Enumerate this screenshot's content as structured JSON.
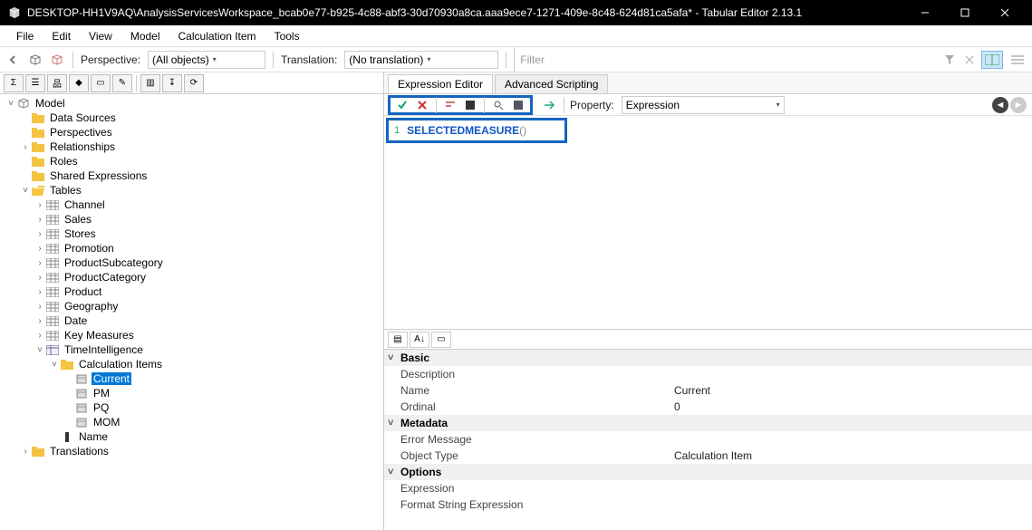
{
  "window": {
    "title": "DESKTOP-HH1V9AQ\\AnalysisServicesWorkspace_bcab0e77-b925-4c88-abf3-30d70930a8ca.aaa9ece7-1271-409e-8c48-624d81ca5afa* - Tabular Editor 2.13.1"
  },
  "menu": [
    "File",
    "Edit",
    "View",
    "Model",
    "Calculation Item",
    "Tools"
  ],
  "toolbar": {
    "perspective_label": "Perspective:",
    "perspective_value": "(All objects)",
    "translation_label": "Translation:",
    "translation_value": "(No translation)",
    "filter_placeholder": "Filter"
  },
  "tree": [
    {
      "d": 0,
      "t": "v",
      "i": "cube",
      "l": "Model"
    },
    {
      "d": 1,
      "t": "",
      "i": "folder",
      "l": "Data Sources"
    },
    {
      "d": 1,
      "t": "",
      "i": "folder",
      "l": "Perspectives"
    },
    {
      "d": 1,
      "t": ">",
      "i": "folder",
      "l": "Relationships"
    },
    {
      "d": 1,
      "t": "",
      "i": "folder",
      "l": "Roles"
    },
    {
      "d": 1,
      "t": "",
      "i": "folder",
      "l": "Shared Expressions"
    },
    {
      "d": 1,
      "t": "v",
      "i": "folder-open",
      "l": "Tables"
    },
    {
      "d": 2,
      "t": ">",
      "i": "table",
      "l": "Channel"
    },
    {
      "d": 2,
      "t": ">",
      "i": "table",
      "l": "Sales"
    },
    {
      "d": 2,
      "t": ">",
      "i": "table",
      "l": "Stores"
    },
    {
      "d": 2,
      "t": ">",
      "i": "table",
      "l": "Promotion"
    },
    {
      "d": 2,
      "t": ">",
      "i": "table",
      "l": "ProductSubcategory"
    },
    {
      "d": 2,
      "t": ">",
      "i": "table",
      "l": "ProductCategory"
    },
    {
      "d": 2,
      "t": ">",
      "i": "table",
      "l": "Product"
    },
    {
      "d": 2,
      "t": ">",
      "i": "table",
      "l": "Geography"
    },
    {
      "d": 2,
      "t": ">",
      "i": "table",
      "l": "Date"
    },
    {
      "d": 2,
      "t": ">",
      "i": "table",
      "l": "Key Measures"
    },
    {
      "d": 2,
      "t": "v",
      "i": "calcgroup",
      "l": "TimeIntelligence"
    },
    {
      "d": 3,
      "t": "v",
      "i": "folder",
      "l": "Calculation Items"
    },
    {
      "d": 4,
      "t": "",
      "i": "item",
      "l": "Current",
      "sel": true
    },
    {
      "d": 4,
      "t": "",
      "i": "item",
      "l": "PM"
    },
    {
      "d": 4,
      "t": "",
      "i": "item",
      "l": "PQ"
    },
    {
      "d": 4,
      "t": "",
      "i": "item",
      "l": "MOM"
    },
    {
      "d": 3,
      "t": "",
      "i": "col",
      "l": "Name"
    },
    {
      "d": 1,
      "t": ">",
      "i": "folder",
      "l": "Translations"
    }
  ],
  "tabs": {
    "expression": "Expression Editor",
    "scripting": "Advanced Scripting"
  },
  "editor": {
    "property_label": "Property:",
    "property_value": "Expression",
    "line_number": "1",
    "code_keyword": "SELECTEDMEASURE",
    "code_parens": "()"
  },
  "properties": {
    "categories": [
      {
        "name": "Basic",
        "rows": [
          {
            "n": "Description",
            "v": ""
          },
          {
            "n": "Name",
            "v": "Current"
          },
          {
            "n": "Ordinal",
            "v": "0"
          }
        ]
      },
      {
        "name": "Metadata",
        "rows": [
          {
            "n": "Error Message",
            "v": ""
          },
          {
            "n": "Object Type",
            "v": "Calculation Item"
          }
        ]
      },
      {
        "name": "Options",
        "rows": [
          {
            "n": "Expression",
            "v": ""
          },
          {
            "n": "Format String Expression",
            "v": ""
          }
        ]
      }
    ]
  }
}
